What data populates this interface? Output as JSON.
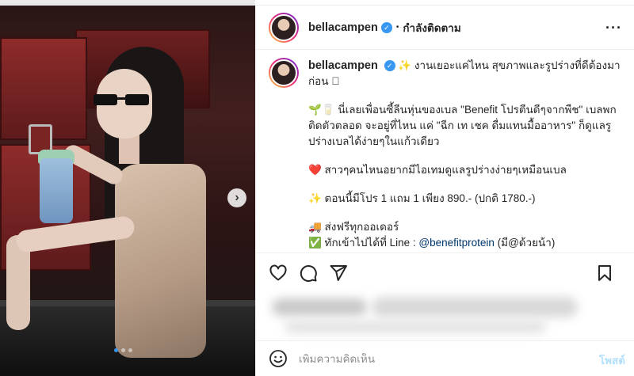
{
  "post": {
    "username": "bellacampen",
    "follow_status": "กำลังติดตาม",
    "separator": "•",
    "more_label": "···",
    "caption": {
      "lines": [
        "✨ งานเยอะแค่ไหน สุขภาพและรูปร่างที่ดีต้องมาก่อน 🏻",
        "🌱🥛 นี่เลยเพื่อนซี้ลีนหุ่นของเบล \"Benefit โปรตีนดีๆจากพืช\" เบลพกติดตัวตลอด จะอยู่ที่ไหน แค่ \"ฉีก เท เชค ดื่มแทนมื้ออาหาร\" ก็ดูแลรูปร่างเบลได้ง่ายๆในแก้วเดียว",
        "❤️ สาวๆคนไหนอยากมีไอเทมดูแลรูปร่างง่ายๆเหมือนเบล",
        "✨ ตอนนี้มีโปร 1 แถม 1 เพียง 890.- (ปกติ 1780.-)",
        "🚚 ส่งฟรีทุกออเดอร์"
      ],
      "last_line_prefix": "✅ ทักเข้าไปได้ที่ Line : ",
      "line_link": "@benefitprotein",
      "last_line_suffix": " (มี@ด้วยน้า)"
    }
  },
  "carousel": {
    "next_icon": "›"
  },
  "comment": {
    "placeholder": "เพิ่มความคิดเห็น",
    "post_label": "โพสต์"
  },
  "colors": {
    "verified": "#3897f0",
    "link": "#00376b",
    "post_button": "#b2dffc"
  }
}
